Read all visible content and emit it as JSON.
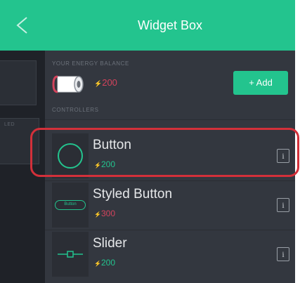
{
  "header": {
    "title": "Widget Box",
    "back_icon": "chevron-left-icon"
  },
  "left_backdrop": {
    "tag": "LED"
  },
  "energy": {
    "label": "YOUR ENERGY BALANCE",
    "balance": "200",
    "currency_glyph": "⚡",
    "battery_icon": "battery-icon",
    "add_label": "+ Add"
  },
  "controllers": {
    "label": "CONTROLLERS",
    "items": [
      {
        "title": "Button",
        "cost": "200",
        "cost_glyph": "⚡",
        "info": "i",
        "icon": "button-circle-icon",
        "highlighted": true
      },
      {
        "title": "Styled Button",
        "cost": "300",
        "cost_glyph": "⚡",
        "info": "i",
        "icon": "styled-button-icon",
        "thumb_text": "Button"
      },
      {
        "title": "Slider",
        "cost": "200",
        "cost_glyph": "⚡",
        "info": "i",
        "icon": "slider-icon"
      }
    ]
  },
  "colors": {
    "accent": "#23c48e",
    "panel": "#33373f",
    "cost_alert": "#d3435c",
    "highlight": "#d3303a"
  }
}
